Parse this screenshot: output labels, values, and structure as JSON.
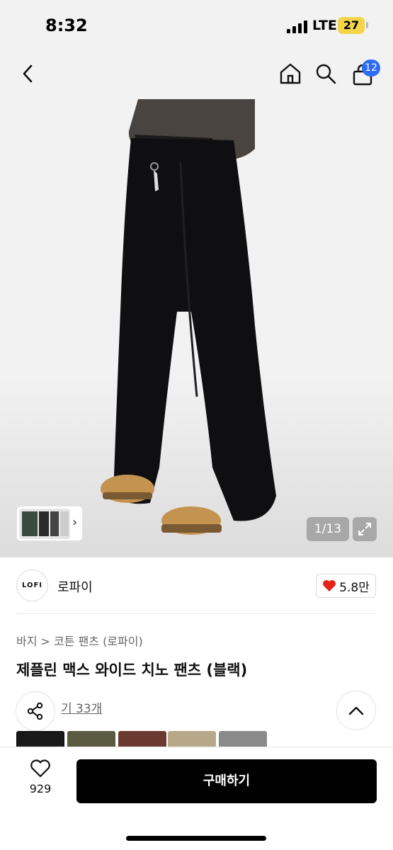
{
  "status": {
    "time": "8:32",
    "network": "LTE",
    "battery": "27"
  },
  "nav": {
    "back_icon": "chevron-left-icon",
    "home_icon": "home-icon",
    "search_icon": "search-icon",
    "cart_icon": "bag-icon",
    "cart_count": "12"
  },
  "gallery": {
    "page_counter": "1/13",
    "expand_icon": "expand-icon"
  },
  "brand": {
    "logo_text": "LOFI",
    "name": "로파이",
    "likes": "5.8만",
    "like_color": "#e5231a"
  },
  "product": {
    "breadcrumb_root": "바지",
    "breadcrumb_sep": ">",
    "breadcrumb_sub": "코튼 팬츠 (로파이)",
    "title": "제플린 맥스 와이드 치노 팬츠 (블랙)",
    "reviews": "기 33개"
  },
  "bottom": {
    "wish_count": "929",
    "buy_label": "구매하기"
  },
  "colors": {
    "accent": "#2d6cf5",
    "buy_bg": "#000000",
    "heart": "#e5231a"
  }
}
